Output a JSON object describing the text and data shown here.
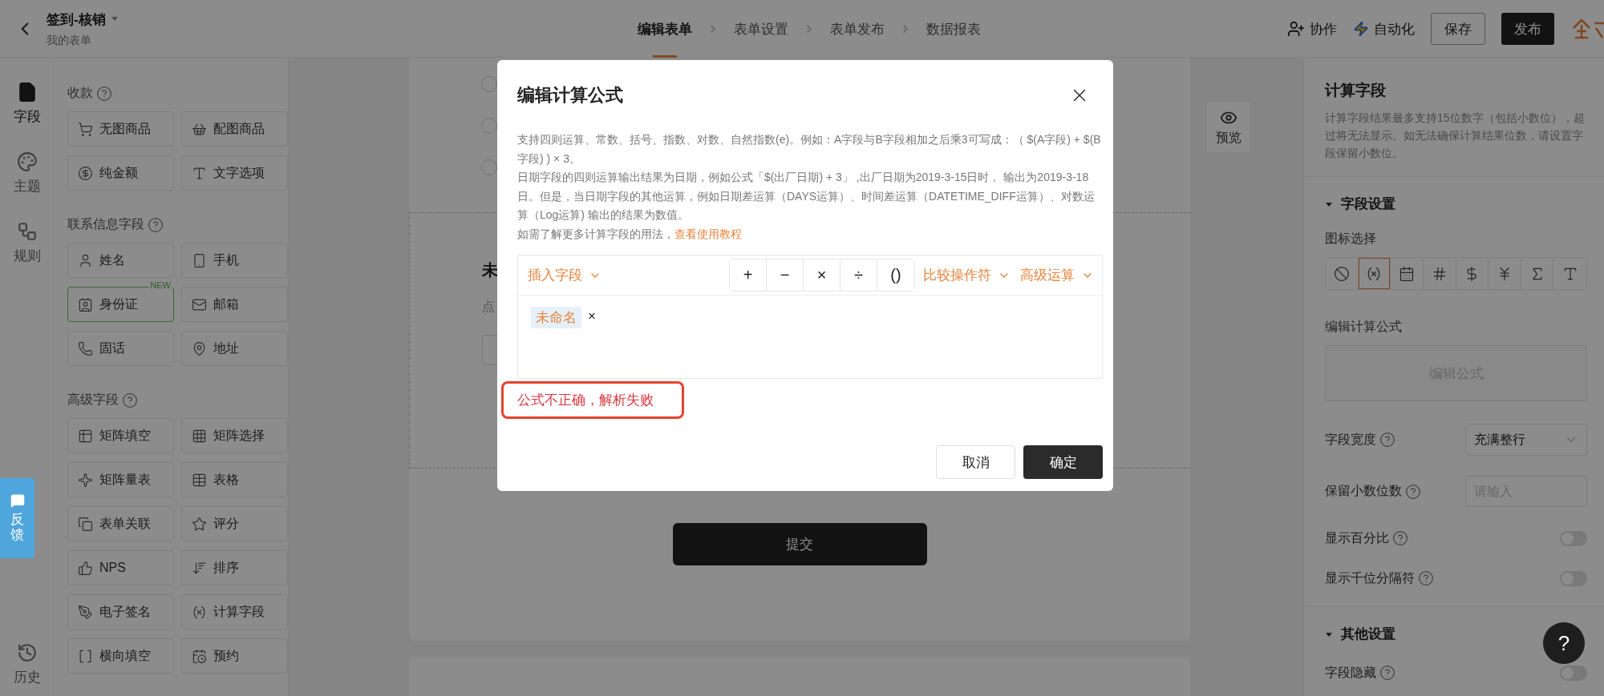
{
  "topbar": {
    "title": "签到-核销",
    "subtitle": "我的表单",
    "steps": [
      {
        "label": "编辑表单",
        "selected": true
      },
      {
        "label": "表单设置",
        "selected": false
      },
      {
        "label": "表单发布",
        "selected": false
      },
      {
        "label": "数据报表",
        "selected": false
      }
    ],
    "collaborate": "协作",
    "automation": "自动化",
    "save": "保存",
    "publish": "发布"
  },
  "rail": {
    "items": [
      {
        "label": "字段",
        "selected": true
      },
      {
        "label": "主题",
        "selected": false
      },
      {
        "label": "规则",
        "selected": false
      },
      {
        "label": "历史",
        "selected": false
      }
    ],
    "feedback": "反馈"
  },
  "field_panel": {
    "sections": [
      {
        "title": "收款",
        "items": [
          {
            "label": "无图商品"
          },
          {
            "label": "配图商品"
          },
          {
            "label": "纯金额"
          },
          {
            "label": "文字选项"
          }
        ]
      },
      {
        "title": "联系信息字段",
        "items": [
          {
            "label": "姓名"
          },
          {
            "label": "手机"
          },
          {
            "label": "身份证",
            "badge": "NEW"
          },
          {
            "label": "邮箱"
          },
          {
            "label": "固话"
          },
          {
            "label": "地址"
          }
        ]
      },
      {
        "title": "高级字段",
        "items": [
          {
            "label": "矩阵填空"
          },
          {
            "label": "矩阵选择"
          },
          {
            "label": "矩阵量表"
          },
          {
            "label": "表格"
          },
          {
            "label": "表单关联"
          },
          {
            "label": "评分"
          },
          {
            "label": "NPS"
          },
          {
            "label": "排序"
          },
          {
            "label": "电子签名"
          },
          {
            "label": "计算字段"
          },
          {
            "label": "横向填空"
          },
          {
            "label": "预约"
          }
        ]
      }
    ]
  },
  "canvas": {
    "options": [
      {
        "selected": false
      },
      {
        "selected": false
      },
      {
        "selected": false
      }
    ],
    "field_title": "未",
    "field_hint": "点",
    "submit": "提交",
    "preview": "预览"
  },
  "right_panel": {
    "title": "计算字段",
    "description": "计算字段结果最多支持15位数字（包括小数位），超过将无法显示。如无法确保计算结果位数，请设置字段保留小数位。",
    "field_settings": {
      "title": "字段设置",
      "expanded": true
    },
    "icon_label": "图标选择",
    "icon_choices": [
      {
        "selected": false
      },
      {
        "selected": true
      },
      {
        "selected": false
      },
      {
        "selected": false
      },
      {
        "selected": false
      },
      {
        "selected": false
      },
      {
        "selected": false
      },
      {
        "selected": false
      }
    ],
    "formula_label": "编辑计算公式",
    "formula_button": "编辑公式",
    "width": {
      "label": "字段宽度",
      "value": "充满整行"
    },
    "decimals": {
      "label": "保留小数位数",
      "placeholder": "请输入"
    },
    "toggles": [
      {
        "label": "显示百分比",
        "on": false
      },
      {
        "label": "显示千位分隔符",
        "on": false
      }
    ],
    "other_settings": {
      "title": "其他设置",
      "expanded": true
    },
    "other_toggles": [
      {
        "label": "字段隐藏",
        "on": false
      }
    ]
  },
  "modal": {
    "title": "编辑计算公式",
    "paragraphs": [
      "支持四则运算、常数、括号、指数、对数、自然指数(e)。例如：A字段与B字段相加之后乘3可写成：（ $(A字段) + $(B字段) ) × 3。",
      "日期字段的四则运算输出结果为日期，例如公式「$(出厂日期) + 3」 ,出厂日期为2019-3-15日时， 输出为2019-3-18日。但是，当日期字段的其他运算，例如日期差运算（DAYS运算）、时间差运算（DATETIME_DIFF运算）、对数运算（Log运算) 输出的结果为数值。"
    ],
    "help_text": "如需了解更多计算字段的用法，",
    "help_link": "查看使用教程",
    "insert_field": "插入字段",
    "operators": [
      "+",
      "−",
      "×",
      "÷",
      "()"
    ],
    "compare": "比较操作符",
    "advanced": "高级运算",
    "tokens": [
      {
        "label": "未命名",
        "remove": "×"
      }
    ],
    "error": "公式不正确，解析失败",
    "cancel": "取消",
    "confirm": "确定"
  },
  "help_button": "?"
}
